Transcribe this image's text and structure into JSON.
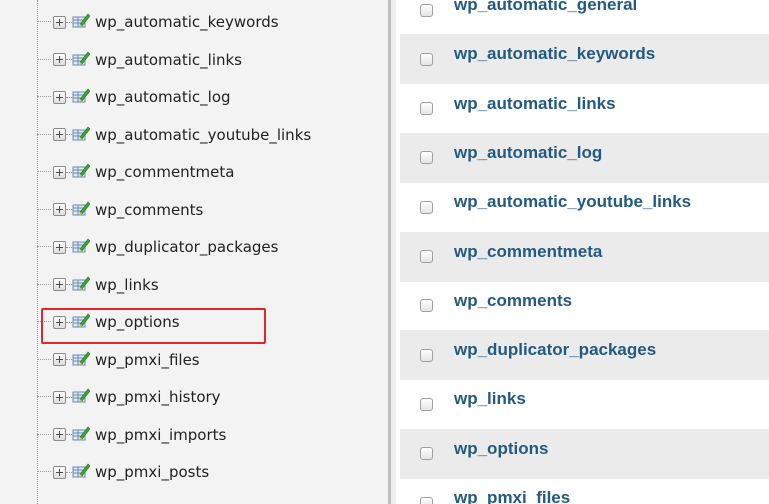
{
  "navigation": {
    "items": [
      {
        "label": "wp_automatic_keywords"
      },
      {
        "label": "wp_automatic_links"
      },
      {
        "label": "wp_automatic_log"
      },
      {
        "label": "wp_automatic_youtube_links"
      },
      {
        "label": "wp_commentmeta"
      },
      {
        "label": "wp_comments"
      },
      {
        "label": "wp_duplicator_packages"
      },
      {
        "label": "wp_links"
      },
      {
        "label": "wp_options",
        "highlighted": true
      },
      {
        "label": "wp_pmxi_files"
      },
      {
        "label": "wp_pmxi_history"
      },
      {
        "label": "wp_pmxi_imports"
      },
      {
        "label": "wp_pmxi_posts"
      }
    ]
  },
  "table_list": {
    "rows": [
      {
        "label": "wp_automatic_general",
        "partial": true
      },
      {
        "label": "wp_automatic_keywords"
      },
      {
        "label": "wp_automatic_links"
      },
      {
        "label": "wp_automatic_log"
      },
      {
        "label": "wp_automatic_youtube_links"
      },
      {
        "label": "wp_commentmeta"
      },
      {
        "label": "wp_comments"
      },
      {
        "label": "wp_duplicator_packages"
      },
      {
        "label": "wp_links"
      },
      {
        "label": "wp_options"
      },
      {
        "label": "wp_pmxi_files",
        "partial": true
      }
    ]
  },
  "icons": {
    "expander": "plus-box-icon",
    "table": "table-edit-icon",
    "checkbox": "checkbox"
  },
  "colors": {
    "link": "#235a81",
    "highlight_border": "#e3262c",
    "row_alt_bg": "#ebebeb",
    "nav_bg": "#f3f3f3"
  }
}
